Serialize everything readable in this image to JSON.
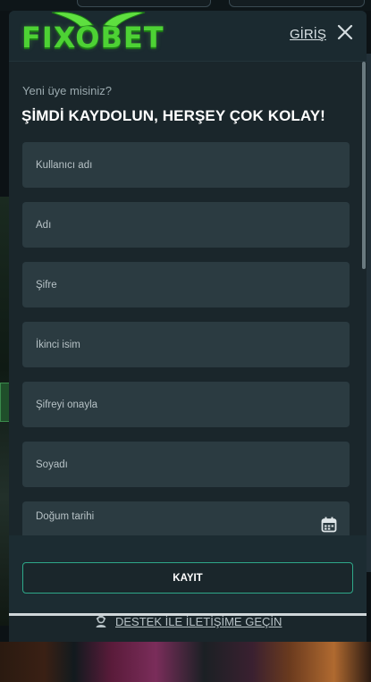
{
  "header": {
    "logo_text": "FIXOBET",
    "login_label": "GİRİŞ",
    "close_icon": "close-icon"
  },
  "intro": {
    "subtitle": "Yeni üye misiniz?",
    "headline": "ŞİMDİ KAYDOLUN, HERŞEY ÇOK KOLAY!"
  },
  "form": {
    "fields": [
      {
        "placeholder": "Kullanıcı adı",
        "value": ""
      },
      {
        "placeholder": "Adı",
        "value": ""
      },
      {
        "placeholder": "Şifre",
        "value": ""
      },
      {
        "placeholder": "İkinci isim",
        "value": ""
      },
      {
        "placeholder": "Şifreyi onayla",
        "value": ""
      },
      {
        "placeholder": "Soyadı",
        "value": ""
      },
      {
        "placeholder": "Doğum tarihi",
        "value": "",
        "icon": "calendar-icon"
      }
    ],
    "register_label": "KAYIT"
  },
  "support": {
    "label": "DESTEK İLE İLETİŞİME GEÇİN",
    "icon": "support-agent-icon"
  },
  "colors": {
    "accent": "#2ea889",
    "brand_green": "#4dd234",
    "modal_bg": "#1a262b",
    "field_bg": "#2b3b41"
  }
}
